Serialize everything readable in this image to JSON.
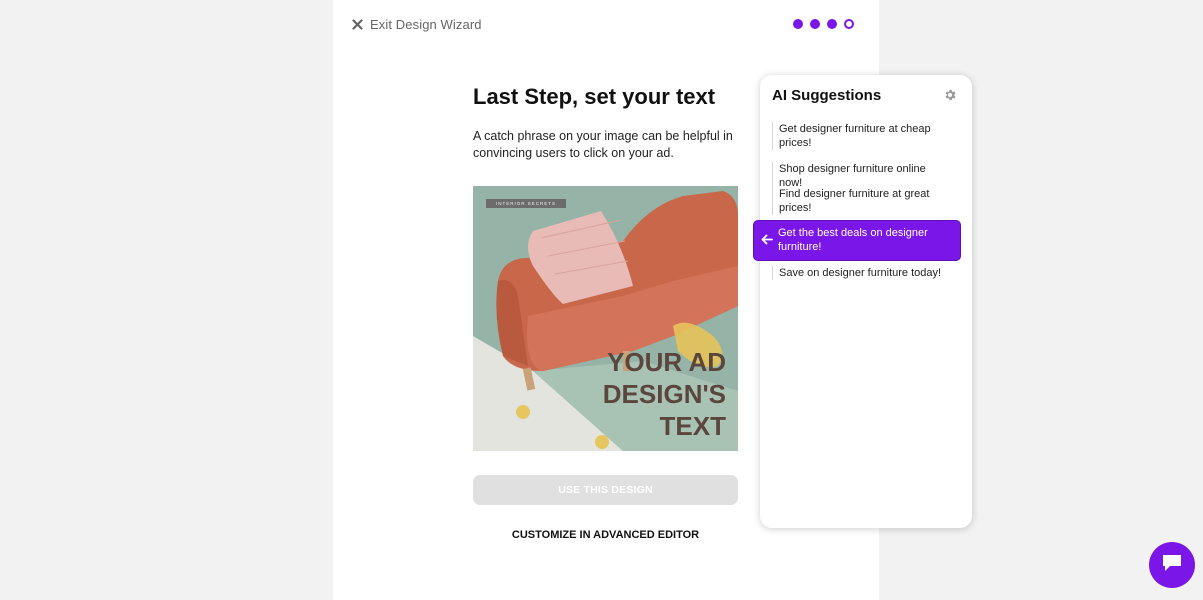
{
  "header": {
    "exit_label": "Exit Design Wizard",
    "steps_total": 4,
    "current_step": 4
  },
  "step": {
    "title": "Last Step, set your text",
    "description": "A catch phrase on your image can be helpful in convincing users to click on your ad."
  },
  "preview": {
    "tag": "INTERIOR SECRETS",
    "ad_text": "YOUR AD\nDESIGN'S\nTEXT"
  },
  "actions": {
    "use_design_label": "USE THIS DESIGN",
    "customize_label": "CUSTOMIZE IN ADVANCED EDITOR"
  },
  "ai_panel": {
    "title": "AI Suggestions",
    "suggestions": [
      {
        "text": "Get designer furniture at cheap prices!",
        "selected": false
      },
      {
        "text": "Shop designer furniture online now!",
        "selected": false
      },
      {
        "text": "Find designer furniture at great prices!",
        "selected": false
      },
      {
        "text": "Get the best deals on designer furniture!",
        "selected": true
      },
      {
        "text": "Save on designer furniture today!",
        "selected": false
      }
    ]
  },
  "icons": {
    "exit": "close-icon",
    "settings": "gear-icon",
    "apply": "arrow-left-icon",
    "chat": "chat-bubble-icon"
  },
  "colors": {
    "accent": "#7b16e8",
    "background": "#f2f2f2",
    "disabled_button": "#e0e0e0",
    "ad_text": "#5a463c"
  }
}
